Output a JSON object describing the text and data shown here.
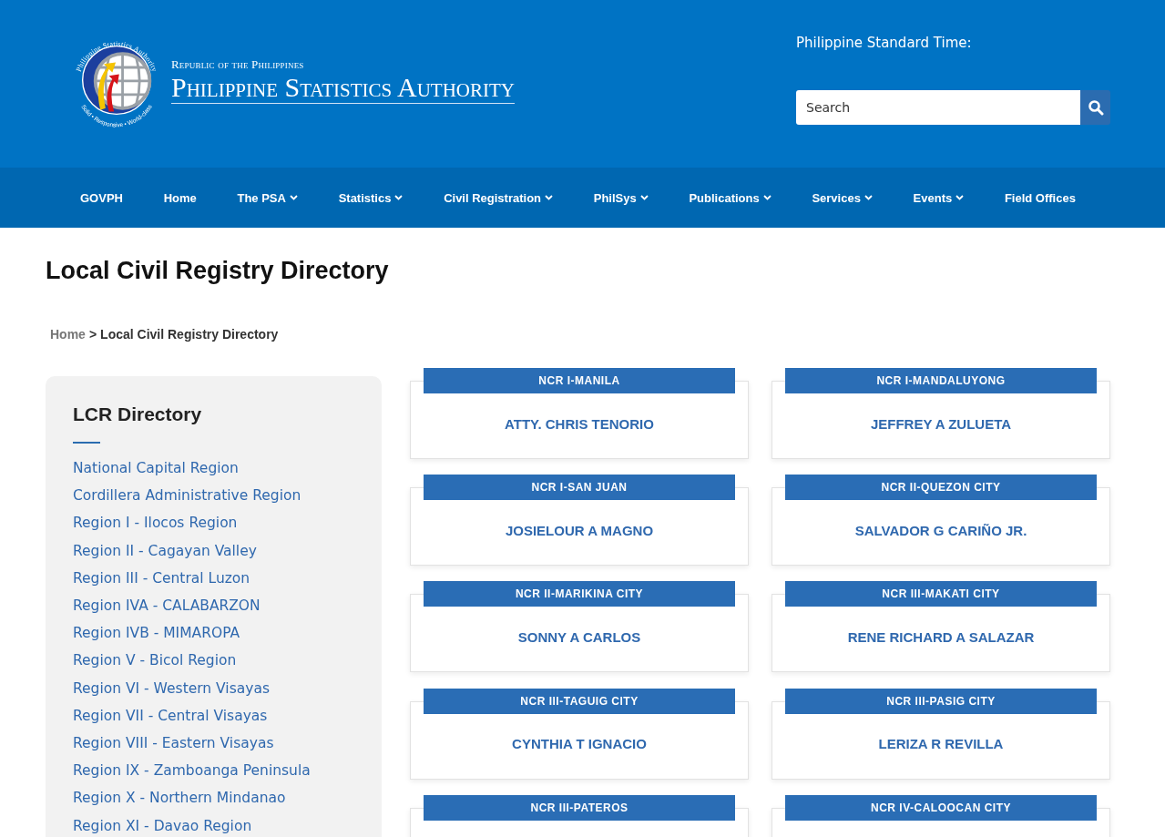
{
  "header": {
    "seal_ring_text": "Philippine Statistics Authority",
    "seal_motto": "Solid • Responsive • World-class",
    "logo_kicker": "Republic of the Philippines",
    "logo_title": "Philippine Statistics Authority",
    "time_label": "Philippine Standard Time:",
    "search": {
      "placeholder": "Search"
    }
  },
  "nav": [
    {
      "label": "GOVPH",
      "has_dropdown": false
    },
    {
      "label": "Home",
      "has_dropdown": false
    },
    {
      "label": "The PSA",
      "has_dropdown": true
    },
    {
      "label": "Statistics",
      "has_dropdown": true
    },
    {
      "label": "Civil Registration",
      "has_dropdown": true
    },
    {
      "label": "PhilSys",
      "has_dropdown": true
    },
    {
      "label": "Publications",
      "has_dropdown": true
    },
    {
      "label": "Services",
      "has_dropdown": true
    },
    {
      "label": "Events",
      "has_dropdown": true
    },
    {
      "label": "Field Offices",
      "has_dropdown": false
    }
  ],
  "page_title": "Local Civil Registry Directory",
  "breadcrumb": {
    "home": "Home",
    "separator": ">",
    "current": "Local Civil Registry Directory"
  },
  "sidebar": {
    "title": "LCR Directory",
    "items": [
      "National Capital Region",
      "Cordillera Administrative Region",
      "Region I - Ilocos Region",
      "Region II - Cagayan Valley",
      "Region III - Central Luzon",
      "Region IVA - CALABARZON",
      "Region IVB - MIMAROPA",
      "Region V - Bicol Region",
      "Region VI - Western Visayas",
      "Region VII - Central Visayas",
      "Region VIII - Eastern Visayas",
      "Region IX - Zamboanga Peninsula",
      "Region X - Northern Mindanao",
      "Region XI - Davao Region"
    ]
  },
  "cards": [
    {
      "office": "NCR I-MANILA",
      "name": "ATTY. CHRIS TENORIO"
    },
    {
      "office": "NCR I-MANDALUYONG",
      "name": "JEFFREY A ZULUETA"
    },
    {
      "office": "NCR I-SAN JUAN",
      "name": "JOSIELOUR A MAGNO"
    },
    {
      "office": "NCR II-QUEZON CITY",
      "name": "SALVADOR G CARIÑO JR."
    },
    {
      "office": "NCR II-MARIKINA CITY",
      "name": "SONNY A CARLOS"
    },
    {
      "office": "NCR III-MAKATI CITY",
      "name": "RENE RICHARD A SALAZAR"
    },
    {
      "office": "NCR III-TAGUIG CITY",
      "name": "CYNTHIA T IGNACIO"
    },
    {
      "office": "NCR III-PASIG CITY",
      "name": "LERIZA R REVILLA"
    },
    {
      "office": "NCR III-PATEROS"
    },
    {
      "office": "NCR IV-CALOOCAN CITY"
    }
  ]
}
